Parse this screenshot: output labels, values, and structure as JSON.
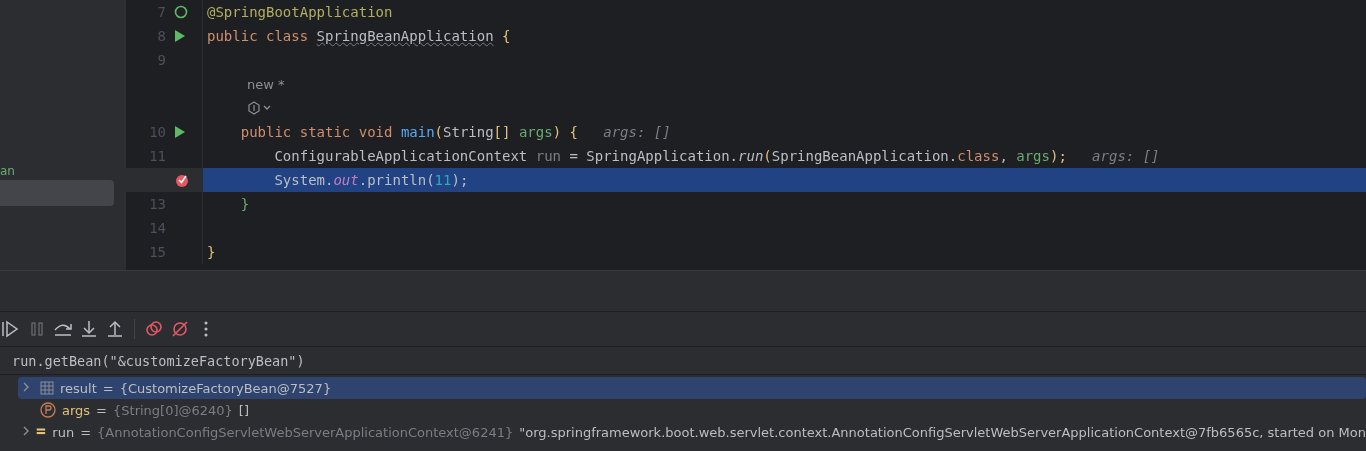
{
  "sidebar": {
    "items": [
      {
        "label": "an",
        "selected": false
      },
      {
        "selected": true
      }
    ]
  },
  "editor": {
    "lines": [
      {
        "kind": "code",
        "number": "7",
        "gutter_icon": {
          "kind": "bean"
        },
        "highlighted": false,
        "tokens": [
          {
            "text": "@SpringBootApplication",
            "kind": "annotation"
          }
        ]
      },
      {
        "kind": "code",
        "number": "8",
        "gutter_icon": {
          "kind": "run"
        },
        "highlighted": false,
        "tokens": [
          {
            "text": "public class ",
            "kind": "keyword"
          },
          {
            "text": "SpringBeanApplication",
            "kind": "typo"
          },
          {
            "text": " {",
            "kind": "brace"
          }
        ]
      },
      {
        "kind": "code",
        "number": "9",
        "highlighted": false
      },
      {
        "kind": "author",
        "text": "new *"
      },
      {
        "kind": "inlay"
      },
      {
        "kind": "code",
        "number": "10",
        "gutter_icon": {
          "kind": "run"
        },
        "highlighted": false,
        "tokens": [
          {
            "text": "    public static void ",
            "kind": "keyword"
          },
          {
            "text": "main",
            "kind": "method"
          },
          {
            "text": "(",
            "kind": "brace"
          },
          {
            "text": "String",
            "kind": "plain"
          },
          {
            "text": "[] ",
            "kind": "brace"
          },
          {
            "text": "args",
            "kind": "param"
          },
          {
            "text": ") {",
            "kind": "brace"
          },
          {
            "text": "   args: []",
            "kind": "hint"
          }
        ]
      },
      {
        "kind": "code",
        "number": "11",
        "highlighted": false,
        "tokens": [
          {
            "text": "        ConfigurableApplicationContext ",
            "kind": "plain"
          },
          {
            "text": "run",
            "kind": "muted"
          },
          {
            "text": " = SpringApplication.",
            "kind": "plain"
          },
          {
            "text": "run",
            "kind": "static"
          },
          {
            "text": "(",
            "kind": "brace"
          },
          {
            "text": "SpringBeanApplication.",
            "kind": "plain"
          },
          {
            "text": "class",
            "kind": "keyword"
          },
          {
            "text": ", ",
            "kind": "plain"
          },
          {
            "text": "args",
            "kind": "param"
          },
          {
            "text": ");",
            "kind": "brace"
          },
          {
            "text": "   args: []",
            "kind": "hint"
          }
        ]
      },
      {
        "kind": "code",
        "gutter_icon": {
          "kind": "breakpoint"
        },
        "highlighted": true,
        "tokens": [
          {
            "text": "        System.",
            "kind": "plain"
          },
          {
            "text": "out",
            "kind": "field"
          },
          {
            "text": ".println(",
            "kind": "plain"
          },
          {
            "text": "11",
            "kind": "number"
          },
          {
            "text": ");",
            "kind": "plain"
          }
        ]
      },
      {
        "kind": "code",
        "number": "13",
        "highlighted": false,
        "tokens": [
          {
            "text": "    }",
            "kind": "green"
          }
        ]
      },
      {
        "kind": "code",
        "number": "14",
        "highlighted": false
      },
      {
        "kind": "code",
        "number": "15",
        "highlighted": false,
        "tokens": [
          {
            "text": "}",
            "kind": "brace"
          }
        ]
      }
    ]
  },
  "debugger": {
    "toolbar": [
      {
        "kind": "resume"
      },
      {
        "kind": "pause",
        "disabled": true
      },
      {
        "kind": "step-over"
      },
      {
        "kind": "step-into"
      },
      {
        "kind": "step-out"
      },
      {
        "kind": "sep"
      },
      {
        "kind": "breakpoints"
      },
      {
        "kind": "mute"
      },
      {
        "kind": "more"
      }
    ],
    "expression": "run.getBean(\"&customizeFactoryBean\")",
    "variables": [
      {
        "kind": "object",
        "expandable": true,
        "selected": true,
        "name": "result",
        "sign": "=",
        "value": "{CustomizeFactoryBean@7527}"
      },
      {
        "kind": "param",
        "expandable": false,
        "selected": false,
        "name": "args",
        "sign": "=",
        "value": "{String[0]@6240}",
        "extra": "[]"
      },
      {
        "kind": "field",
        "expandable": true,
        "selected": false,
        "name": "run",
        "sign": "=",
        "value": "{AnnotationConfigServletWebServerApplicationContext@6241}",
        "extra": "\"org.springframework.boot.web.servlet.context.AnnotationConfigServletWebServerApplicationContext@7fb6565c, started on Mon"
      }
    ]
  }
}
